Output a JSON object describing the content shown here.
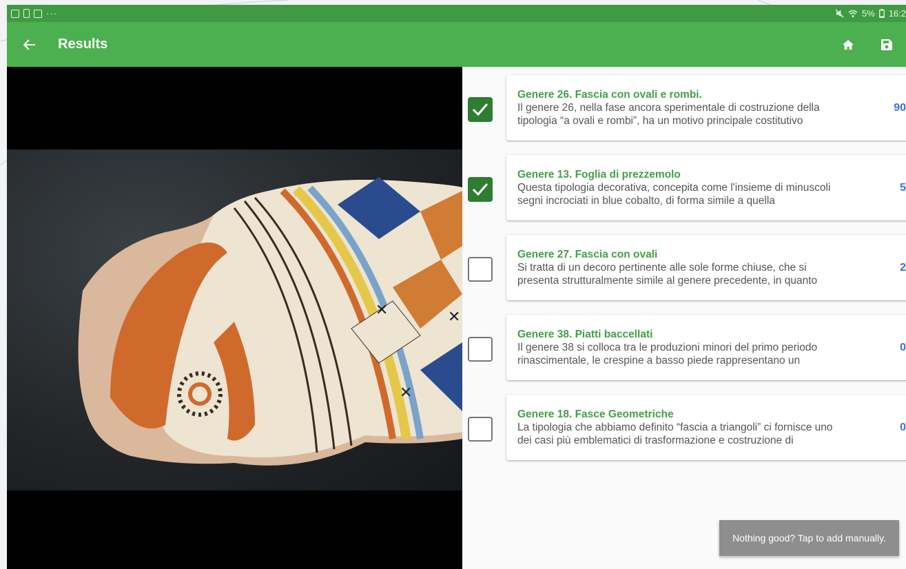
{
  "status_bar": {
    "dots": "···",
    "battery_text": "5%",
    "time": "16:2"
  },
  "app_bar": {
    "back_icon": "arrow-left-icon",
    "title": "Results",
    "home_icon": "home-icon",
    "save_icon": "save-icon"
  },
  "results": [
    {
      "checked": true,
      "title": "Genere 26. Fascia con ovali e rombi.",
      "description": "Il genere 26, nella fase ancora sperimentale di costruzione della tipologia “a ovali e rombi”,  ha un motivo principale costitutivo",
      "score": "90"
    },
    {
      "checked": true,
      "title": "Genere 13. Foglia di prezzemolo",
      "description": "Questa tipologia decorativa, concepita come l'insieme di minuscoli segni incrociati in blue cobalto, di forma simile a quella",
      "score": "5"
    },
    {
      "checked": false,
      "title": "Genere 27. Fascia con ovali",
      "description": "Si tratta di un decoro pertinente alle sole forme chiuse, che si presenta strutturalmente simile al genere precedente, in quanto",
      "score": "2"
    },
    {
      "checked": false,
      "title": "Genere 38. Piatti baccellati",
      "description": "Il genere 38 si colloca tra le produzioni minori del primo periodo rinascimentale, le crespine a basso piede rappresentano un",
      "score": "0"
    },
    {
      "checked": false,
      "title": "Genere 18. Fasce Geometriche",
      "description": "La tipologia che abbiamo definito “fascia a triangoli” ci fornisce uno dei casi più emblematici di trasformazione e costruzione di",
      "score": "0"
    }
  ],
  "snackbar": {
    "text": "Nothing good? Tap to add manually."
  },
  "colors": {
    "status_bar": "#3f9b43",
    "app_bar": "#4caf50",
    "title_green": "#43a047",
    "checkbox_checked": "#2e7d32",
    "score_blue": "#3f6fd8"
  }
}
